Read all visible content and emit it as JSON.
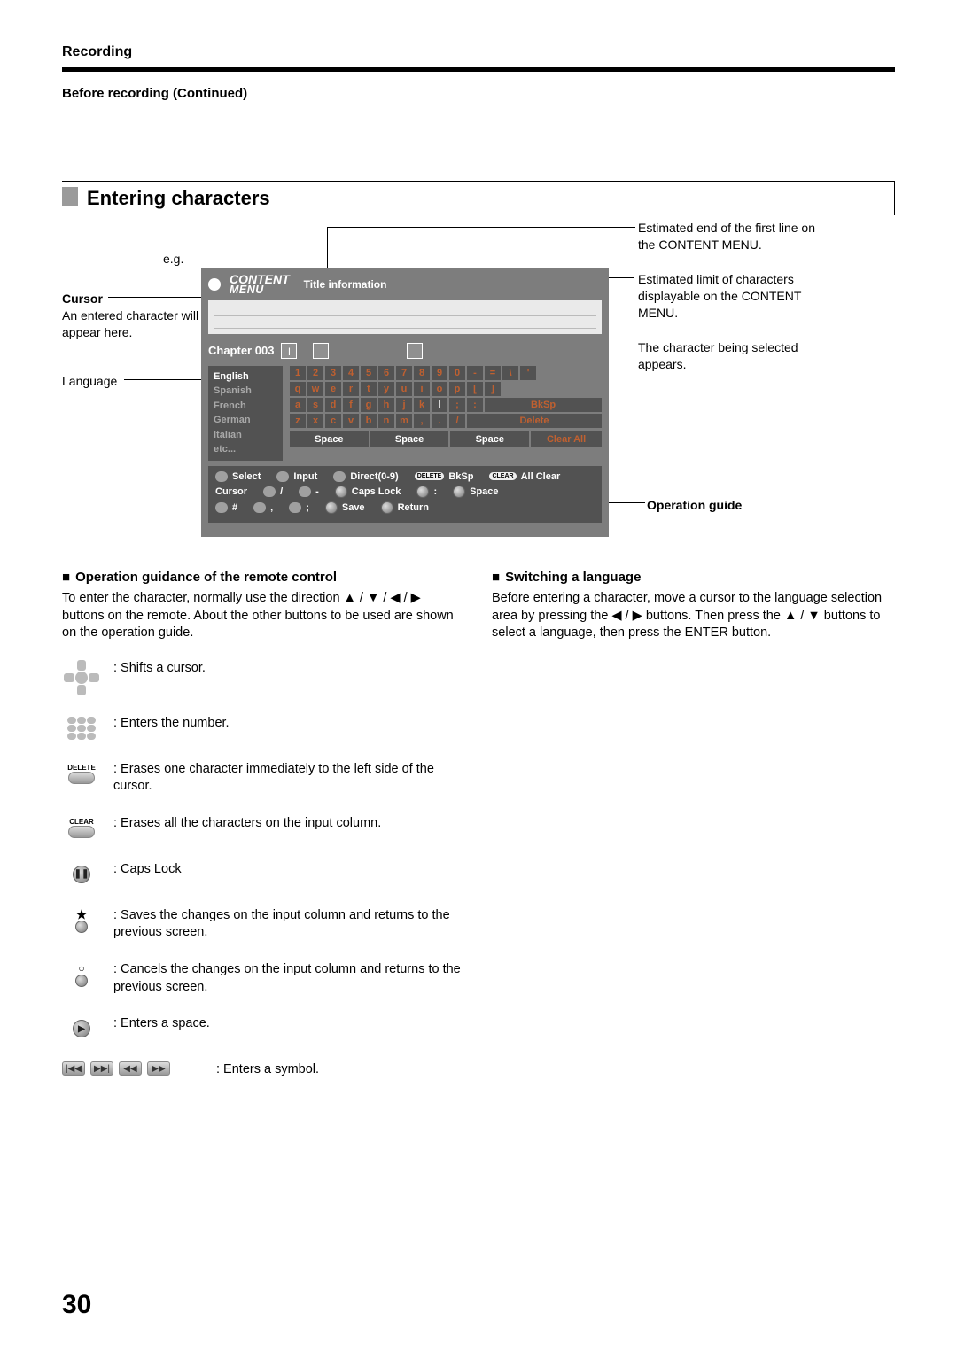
{
  "header": {
    "section": "Recording",
    "subsection": "Before recording (Continued)"
  },
  "section_title": "Entering characters",
  "left_labels": {
    "eg": "e.g.",
    "cursor_title": "Cursor",
    "cursor_body": "An entered character will appear here.",
    "language": "Language"
  },
  "right_labels": {
    "end_line": "Estimated end of the first line on the CONTENT MENU.",
    "limit": "Estimated limit of characters displayable on the CONTENT MENU.",
    "selected": "The character being selected appears.",
    "op_guide": "Operation guide"
  },
  "panel": {
    "content": "CONTENT",
    "menu": "MENU",
    "title_info": "Title information",
    "chapter": "Chapter 003",
    "selected_char": "l",
    "languages": [
      "English",
      "Spanish",
      "French",
      "German",
      "Italian",
      "etc..."
    ],
    "rows": {
      "r1": [
        "1",
        "2",
        "3",
        "4",
        "5",
        "6",
        "7",
        "8",
        "9",
        "0",
        "-",
        "=",
        "\\",
        "'"
      ],
      "r2": [
        "q",
        "w",
        "e",
        "r",
        "t",
        "y",
        "u",
        "i",
        "o",
        "p",
        "[",
        "]"
      ],
      "r3": [
        "a",
        "s",
        "d",
        "f",
        "g",
        "h",
        "j",
        "k",
        "l",
        ";",
        ":"
      ],
      "r3_right": "BkSp",
      "r4": [
        "z",
        "x",
        "c",
        "v",
        "b",
        "n",
        "m",
        ",",
        ".",
        "/"
      ],
      "r4_right": "Delete",
      "space": "Space",
      "clear_all": "Clear All"
    },
    "guide": {
      "select": "Select",
      "input": "Input",
      "direct": "Direct(0-9)",
      "bksp": "BkSp",
      "allclear": "All Clear",
      "cursor": "Cursor",
      "slash": "/",
      "dash": "-",
      "caps": "Caps Lock",
      "colon": ":",
      "space": "Space",
      "hash": "#",
      "comma": ",",
      "semi": ";",
      "save": "Save",
      "ret": "Return",
      "delete_pill": "DELETE",
      "clear_pill": "CLEAR"
    }
  },
  "left_col": {
    "title": "Operation guidance of the remote control",
    "intro": "To enter the character, normally use the direction ▲ / ▼ / ◀ / ▶ buttons on the remote. About the other buttons to be used are shown on the operation guide.",
    "items": {
      "shift": ": Shifts a cursor.",
      "number": ": Enters the number.",
      "delete": ": Erases one character immediately to the left side of the cursor.",
      "clear": ": Erases all the characters on the input column.",
      "caps": ": Caps Lock",
      "save": ": Saves the changes on the input column and returns to the previous screen.",
      "cancel": ": Cancels the changes on the input column and returns to the previous screen.",
      "space": ": Enters a space.",
      "symbol": ": Enters a symbol.",
      "delete_label": "DELETE",
      "clear_label": "CLEAR"
    }
  },
  "right_col": {
    "title": "Switching a language",
    "body": "Before entering a character, move a cursor to the language selection area by pressing the ◀ / ▶ buttons. Then press the ▲ / ▼ buttons to select a language, then press the ENTER button."
  },
  "page_number": "30"
}
